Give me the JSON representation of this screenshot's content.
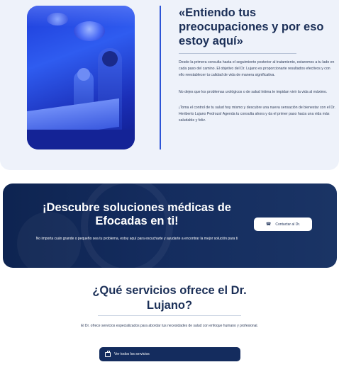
{
  "hero": {
    "title": "«Entiendo tus preocupaciones y por eso estoy aquí»",
    "paragraph_1": "Desde la primera consulta hasta el seguimiento posterior al tratamiento, estaremos a tu lado en cada paso del camino. El objetivo del Dr. Lujano es proporcionarte resultados efectivos y con ello reestablecer tu calidad de vida de manera significativa.",
    "paragraph_2": "No dejes que los problemas urológicos o de salud íntima te impidan vivir la vida al máximo.",
    "paragraph_3": "¡Toma el control de tu salud hoy mismo y descubre una nueva sensación de bienestar con el Dr. Heriberto Lujano Pedroza! Agenda tu consulta ahora y da el primer paso hacia una vida más saludable y feliz."
  },
  "cta_banner": {
    "title": "¡Descubre soluciones médicas de Efocadas en ti!",
    "subtitle": "No importa cuán grande o pequeño sea tu problema, estoy aquí para escucharte y ayudarte a encontrar la mejor solución para ti",
    "button_label": "Contactar al Dr.",
    "button_icon": "phone-icon"
  },
  "services": {
    "title": "¿Qué servicios ofrece el Dr. Lujano?",
    "description": "El Dr. ofrece servicios especializados para abordar tus necesidades de salud con enfoque humano y profesional.",
    "button_label": "Ver todos los servicios",
    "button_icon": "briefcase-icon"
  },
  "colors": {
    "navy": "#142c5e",
    "accent_blue": "#2d55d6",
    "light_bg": "#eef2fa"
  }
}
